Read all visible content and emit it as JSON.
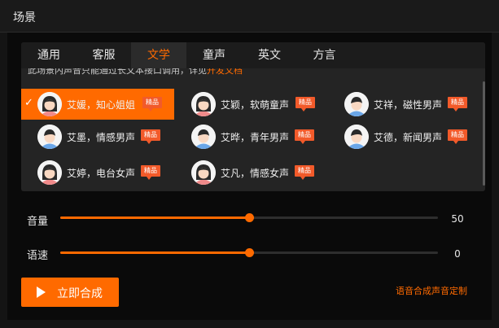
{
  "header": {
    "title": "场景"
  },
  "tabs": [
    {
      "label": "通用",
      "active": false
    },
    {
      "label": "客服",
      "active": false
    },
    {
      "label": "文学",
      "active": true
    },
    {
      "label": "童声",
      "active": false
    },
    {
      "label": "英文",
      "active": false
    },
    {
      "label": "方言",
      "active": false
    }
  ],
  "notice": {
    "text": "此场景内声音只能通过长文本接口调用，详见",
    "link": "开发文档"
  },
  "voices": [
    {
      "name": "艾媛，知心姐姐",
      "badge": "精品",
      "avatar": "female",
      "selected": true
    },
    {
      "name": "艾颖，软萌童声",
      "badge": "精品",
      "avatar": "female",
      "selected": false
    },
    {
      "name": "艾祥，磁性男声",
      "badge": "精品",
      "avatar": "male",
      "selected": false
    },
    {
      "name": "艾墨，情感男声",
      "badge": "精品",
      "avatar": "male",
      "selected": false
    },
    {
      "name": "艾晔，青年男声",
      "badge": "精品",
      "avatar": "male",
      "selected": false
    },
    {
      "name": "艾德，新闻男声",
      "badge": "精品",
      "avatar": "male",
      "selected": false
    },
    {
      "name": "艾婷，电台女声",
      "badge": "精品",
      "avatar": "female",
      "selected": false
    },
    {
      "name": "艾凡，情感女声",
      "badge": "精品",
      "avatar": "female",
      "selected": false
    }
  ],
  "volume": {
    "label": "音量",
    "value": "50",
    "fraction": 0.5
  },
  "speed": {
    "label": "语速",
    "value": "0",
    "fraction": 0.5
  },
  "synthesize_button": {
    "label": "立即合成"
  },
  "custom_voice_link": "语音合成声音定制",
  "colors": {
    "accent": "#ff6a00",
    "badge": "#f25a2a",
    "panel": "#242424",
    "background": "#0a0a0a"
  }
}
